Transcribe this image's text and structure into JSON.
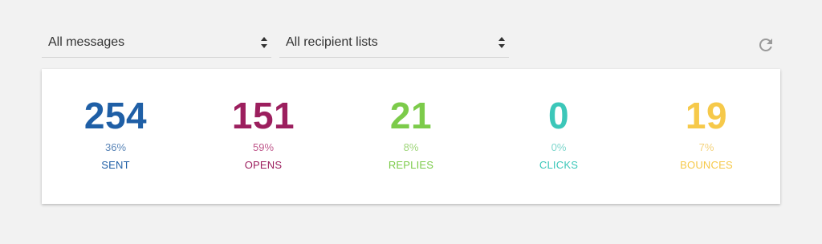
{
  "filters": {
    "messages_select": "All messages",
    "recipients_select": "All recipient lists"
  },
  "icons": {
    "select_arrows": "sort-arrows-icon",
    "refresh": "refresh-icon"
  },
  "stats": [
    {
      "value": "254",
      "percent": "36%",
      "label": "SENT",
      "color": "#1f5fa6",
      "pct_color": "#5b86b8"
    },
    {
      "value": "151",
      "percent": "59%",
      "label": "OPENS",
      "color": "#9c1f5e",
      "pct_color": "#c0598c"
    },
    {
      "value": "21",
      "percent": "8%",
      "label": "REPLIES",
      "color": "#7ccb4a",
      "pct_color": "#9fd67b"
    },
    {
      "value": "0",
      "percent": "0%",
      "label": "CLICKS",
      "color": "#3cc7b9",
      "pct_color": "#7fd7cd"
    },
    {
      "value": "19",
      "percent": "7%",
      "label": "BOUNCES",
      "color": "#f6c94a",
      "pct_color": "#f4d27c"
    }
  ]
}
